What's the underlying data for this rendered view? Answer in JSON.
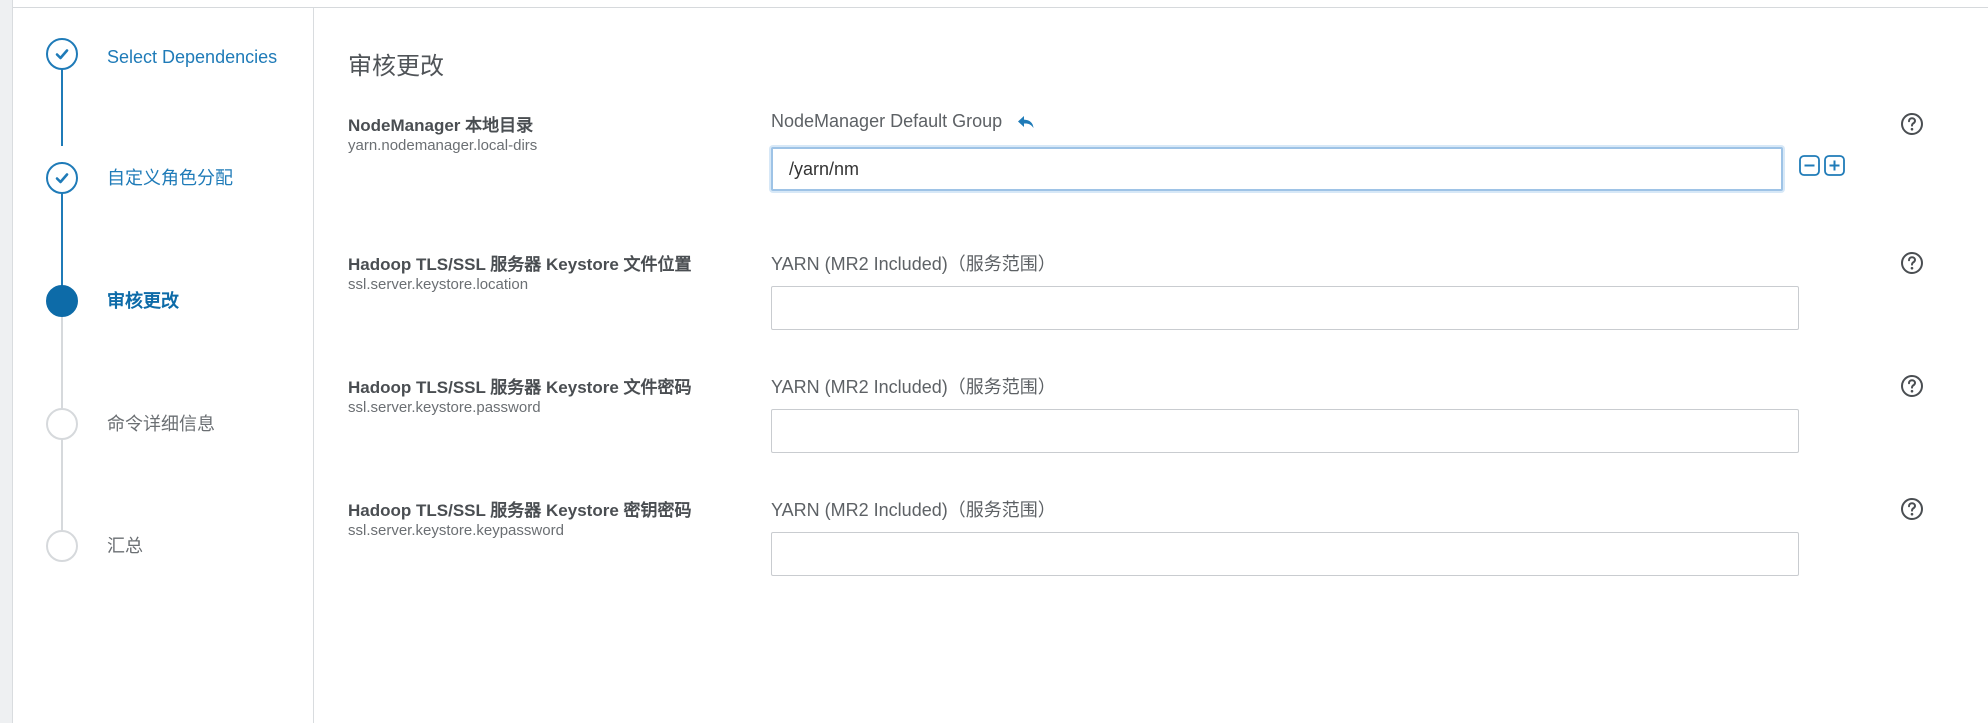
{
  "sidebar": {
    "steps": [
      {
        "label": "Select Dependencies",
        "state": "done"
      },
      {
        "label": "自定义角色分配",
        "state": "done"
      },
      {
        "label": "审核更改",
        "state": "active"
      },
      {
        "label": "命令详细信息",
        "state": "todo"
      },
      {
        "label": "汇总",
        "state": "todo"
      }
    ]
  },
  "main": {
    "title": "审核更改",
    "properties": [
      {
        "name": "NodeManager 本地目录",
        "key": "yarn.nodemanager.local-dirs",
        "scope": "NodeManager Default Group",
        "value": "/yarn/nm",
        "has_revert": true,
        "has_stepper": true
      },
      {
        "name": "Hadoop TLS/SSL 服务器 Keystore 文件位置",
        "key": "ssl.server.keystore.location",
        "scope": "YARN (MR2 Included)（服务范围）",
        "value": ""
      },
      {
        "name": "Hadoop TLS/SSL 服务器 Keystore 文件密码",
        "key": "ssl.server.keystore.password",
        "scope": "YARN (MR2 Included)（服务范围）",
        "value": ""
      },
      {
        "name": "Hadoop TLS/SSL 服务器 Keystore 密钥密码",
        "key": "ssl.server.keystore.keypassword",
        "scope": "YARN (MR2 Included)（服务范围）",
        "value": ""
      }
    ]
  },
  "icons": {
    "step_done": "check-icon",
    "revert": "undo-arrow-icon",
    "remove": "minus-square-icon",
    "add": "plus-square-icon",
    "help": "question-circle-icon"
  },
  "colors": {
    "accent": "#1f7bb8",
    "active": "#0d6ba8",
    "inactive": "#d6d9dc",
    "input_focus": "#9ec3e6"
  }
}
